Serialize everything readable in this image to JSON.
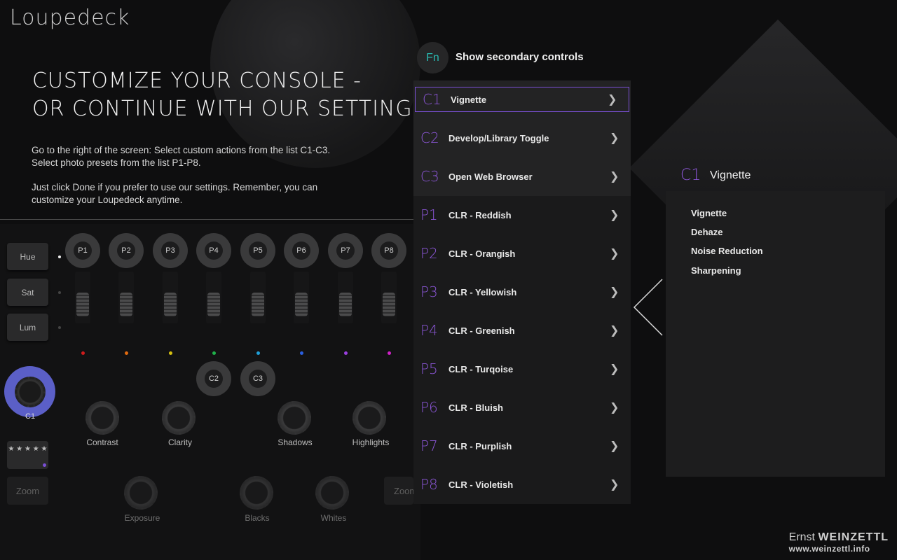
{
  "brand": {
    "logo_text": "Loupedeck"
  },
  "intro": {
    "headline_line1": "CUSTOMIZE YOUR CONSOLE -",
    "headline_line2": "OR CONTINUE WITH OUR SETTINGS",
    "para1_line1": "Go to the right of the screen: Select custom actions from the list C1-C3.",
    "para1_line2": "Select photo presets from the list P1-P8.",
    "para2_line1": "Just click Done if you prefer to use our settings. Remember, you can",
    "para2_line2": "customize your Loupedeck anytime."
  },
  "console": {
    "side_buttons": [
      "Hue",
      "Sat",
      "Lum"
    ],
    "p_buttons": [
      "P1",
      "P2",
      "P3",
      "P4",
      "P5",
      "P6",
      "P7",
      "P8"
    ],
    "channel_colors": [
      "#d01c1c",
      "#e06a10",
      "#d6c010",
      "#1fb14a",
      "#1e9fd8",
      "#2a5fe0",
      "#9a3fe0",
      "#d020c8"
    ],
    "c_buttons": [
      "C2",
      "C3"
    ],
    "dial_label": "C1",
    "accent_color": "#5b5fc7",
    "knobs_row1": [
      "Contrast",
      "Clarity",
      "Shadows",
      "Highlights"
    ],
    "knobs_row2": [
      "Exposure",
      "Blacks",
      "Whites"
    ],
    "stars_glyph": "★ ★ ★ ★ ★",
    "zoom_label": "Zoom",
    "zoom_right_label": "Zoom"
  },
  "fn": {
    "icon_text": "Fn",
    "label": "Show secondary controls"
  },
  "actions": [
    {
      "code": "C1",
      "label": "Vignette",
      "selected": true
    },
    {
      "code": "C2",
      "label": "Develop/Library Toggle"
    },
    {
      "code": "C3",
      "label": "Open Web Browser"
    },
    {
      "code": "P1",
      "label": "CLR - Reddish"
    },
    {
      "code": "P2",
      "label": "CLR - Orangish"
    },
    {
      "code": "P3",
      "label": "CLR - Yellowish"
    },
    {
      "code": "P4",
      "label": "CLR - Greenish"
    },
    {
      "code": "P5",
      "label": "CLR - Turqoise"
    },
    {
      "code": "P6",
      "label": "CLR - Bluish"
    },
    {
      "code": "P7",
      "label": "CLR - Purplish"
    },
    {
      "code": "P8",
      "label": "CLR - Violetish"
    }
  ],
  "detail": {
    "code": "C1",
    "title": "Vignette",
    "options": [
      "Vignette",
      "Dehaze",
      "Noise Reduction",
      "Sharpening"
    ]
  },
  "watermark": {
    "first": "Ernst",
    "last": "WEINZETTL",
    "url": "www.weinzettl.info"
  },
  "colors": {
    "accent_purple": "#8b56d6",
    "fn_teal": "#29b8b0",
    "background": "#0e0e0f"
  }
}
